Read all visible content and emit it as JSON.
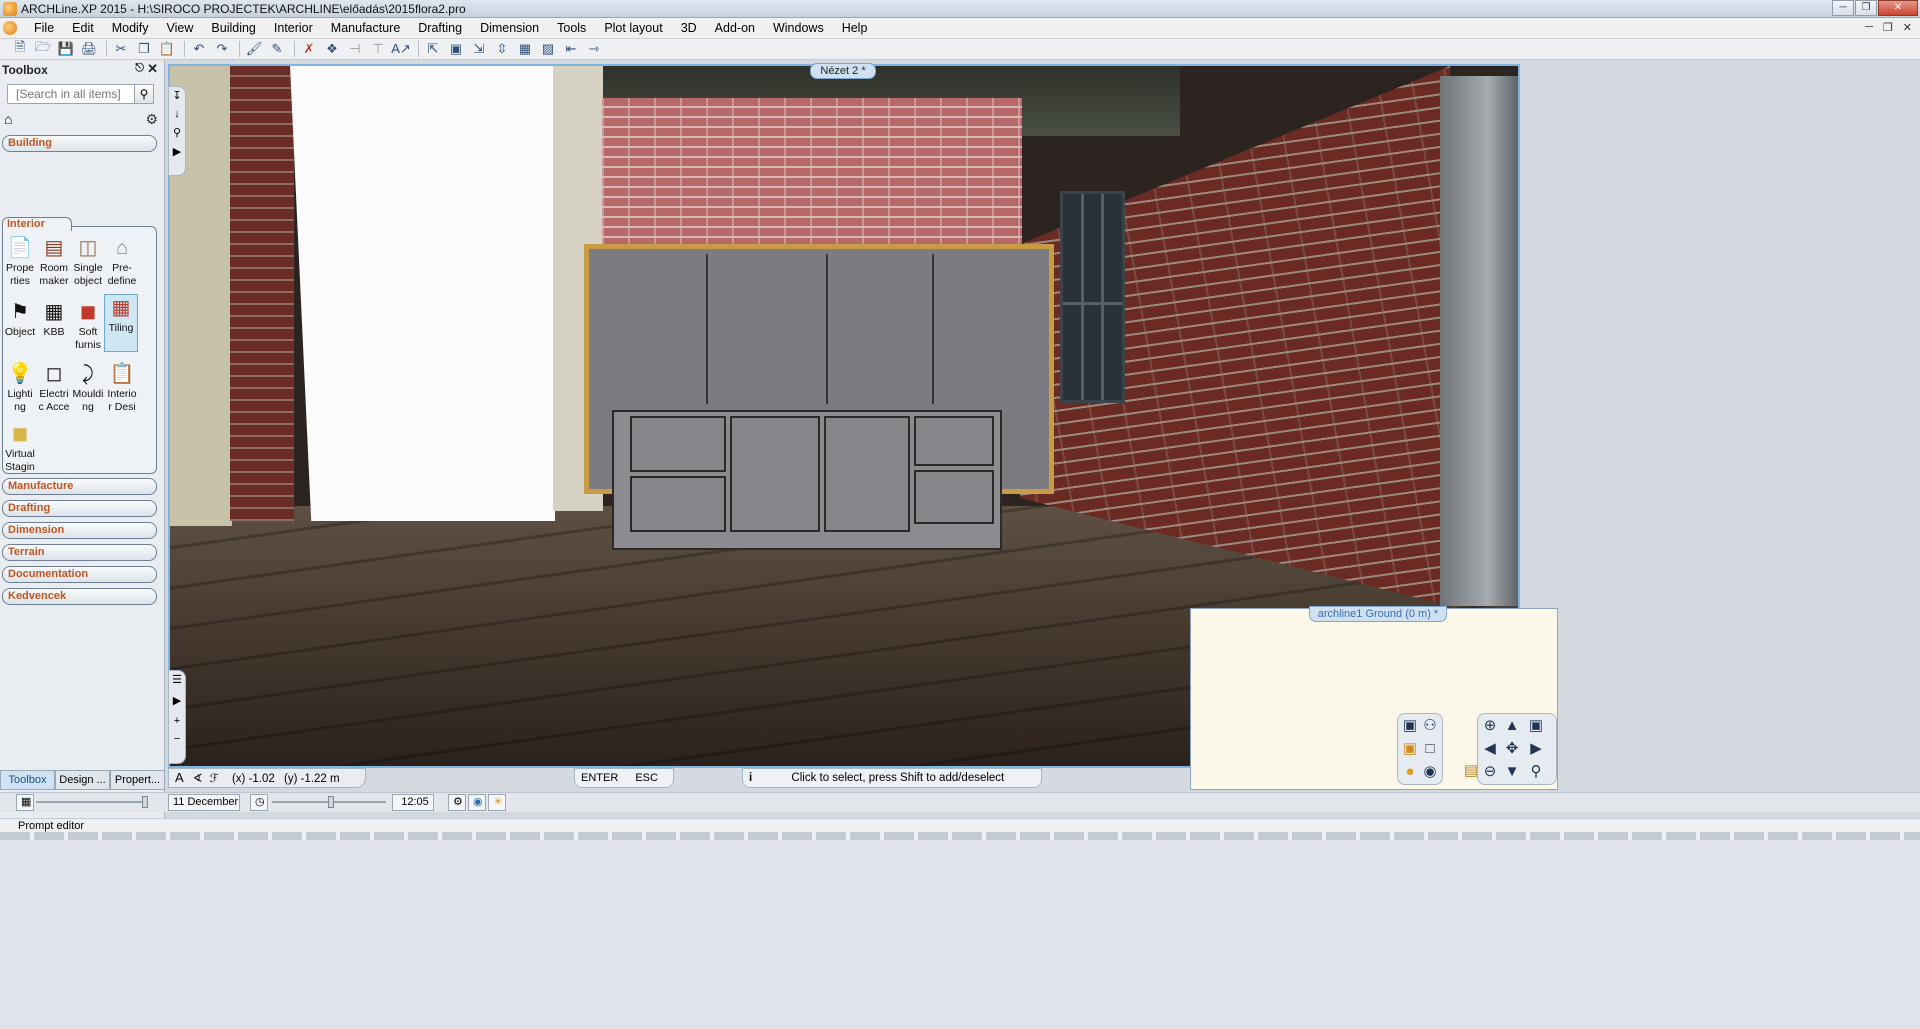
{
  "titlebar": {
    "title": "ARCHLine.XP 2015 - H:\\SIROCO PROJECTEK\\ARCHLINE\\előadás\\2015flora2.pro"
  },
  "menu": [
    "File",
    "Edit",
    "Modify",
    "View",
    "Building",
    "Interior",
    "Manufacture",
    "Drafting",
    "Dimension",
    "Tools",
    "Plot layout",
    "3D",
    "Add-on",
    "Windows",
    "Help"
  ],
  "toolbox": {
    "title": "Toolbox",
    "search_placeholder": "[Search in all items]",
    "categories_top": [
      "Building"
    ],
    "active_category": "Interior",
    "tools": [
      {
        "label": "Prope rties",
        "icon": "properties-icon"
      },
      {
        "label": "Room maker",
        "icon": "room-maker-icon"
      },
      {
        "label": "Single object",
        "icon": "single-object-icon"
      },
      {
        "label": "Pre-define",
        "icon": "predefine-icon"
      },
      {
        "label": "Object",
        "icon": "chair-icon"
      },
      {
        "label": "KBB",
        "icon": "kbb-icon"
      },
      {
        "label": "Soft furnis",
        "icon": "soft-furnishing-icon"
      },
      {
        "label": "Tiling",
        "icon": "tiling-icon"
      },
      {
        "label": "Lighti ng",
        "icon": "bulb-icon"
      },
      {
        "label": "Electri c Acce",
        "icon": "electric-icon"
      },
      {
        "label": "Mouldi ng",
        "icon": "moulding-icon"
      },
      {
        "label": "Interio r Desi",
        "icon": "interior-design-icon"
      },
      {
        "label": "Virtual Stagin",
        "icon": "virtual-staging-icon"
      }
    ],
    "categories_bottom": [
      "Manufacture",
      "Drafting",
      "Dimension",
      "Terrain",
      "Documentation",
      "Kedvencek"
    ],
    "bottom_tabs": [
      "Toolbox",
      "Design ...",
      "Propert..."
    ]
  },
  "viewport": {
    "label": "Nézet 2 *"
  },
  "plan": {
    "label": "archline1 Ground (0 m) *"
  },
  "status": {
    "x_coord": "(x) -1.02",
    "y_coord": "(y) -1.22 m",
    "enter": "ENTER",
    "esc": "ESC",
    "hint": "Click to select, press Shift to add/deselect"
  },
  "sun": {
    "date": "11 December",
    "time": "12:05"
  },
  "prompt_label": "Prompt editor"
}
